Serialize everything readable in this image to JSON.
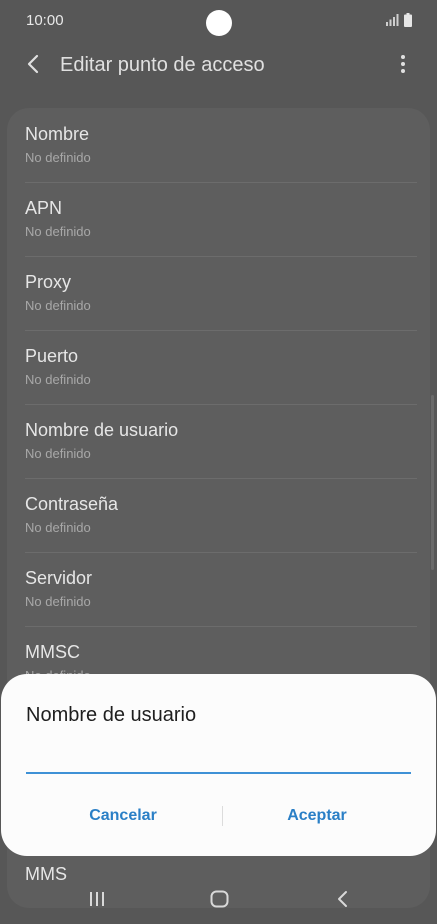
{
  "status_bar": {
    "time": "10:00",
    "signal_icon": "signal-icon",
    "battery_icon": "battery-icon"
  },
  "app_bar": {
    "back_icon": "back-arrow-icon",
    "title": "Editar punto de acceso",
    "more_icon": "more-options-icon"
  },
  "settings_list": {
    "items": [
      {
        "title": "Nombre",
        "value": "No definido"
      },
      {
        "title": "APN",
        "value": "No definido"
      },
      {
        "title": "Proxy",
        "value": "No definido"
      },
      {
        "title": "Puerto",
        "value": "No definido"
      },
      {
        "title": "Nombre de usuario",
        "value": "No definido"
      },
      {
        "title": "Contraseña",
        "value": "No definido"
      },
      {
        "title": "Servidor",
        "value": "No definido"
      },
      {
        "title": "MMSC",
        "value": "No definido"
      },
      {
        "title": "MMS",
        "value": ""
      }
    ]
  },
  "dialog": {
    "title": "Nombre de usuario",
    "input_value": "",
    "cancel_label": "Cancelar",
    "accept_label": "Aceptar"
  },
  "nav_bar": {
    "recent_icon": "recent-apps-icon",
    "home_icon": "home-icon",
    "back_icon": "back-icon"
  },
  "colors": {
    "accent": "#2a7fc6",
    "input_underline": "#3e91d6",
    "dim_background": "#575757",
    "dialog_background": "#fcfcfc"
  }
}
